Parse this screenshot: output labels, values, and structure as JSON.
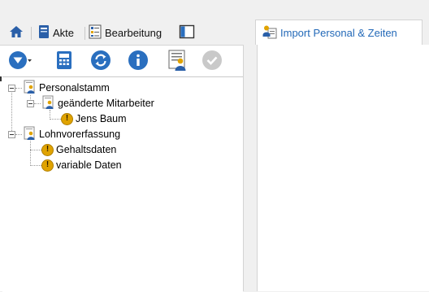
{
  "tabs": {
    "home_icon": "home-icon",
    "akte": "Akte",
    "bearbeitung": "Bearbeitung",
    "layout_icon": "panel-layout-icon"
  },
  "right_tab": {
    "label": "Import Personal & Zeiten",
    "icon": "import-person-icon"
  },
  "toolbar": {
    "icons": [
      "dropdown-filter-icon",
      "calculator-icon",
      "refresh-icon",
      "info-icon",
      "user-report-icon",
      "confirm-icon"
    ]
  },
  "tree": {
    "personalstamm": "Personalstamm",
    "geaenderte_mitarbeiter": "geänderte Mitarbeiter",
    "jens_baum": "Jens Baum",
    "lohnvorerfassung": "Lohnvorerfassung",
    "gehaltsdaten": "Gehaltsdaten",
    "variable_daten": "variable Daten",
    "warn_glyph": "!"
  },
  "colors": {
    "accent_blue": "#2a6fbf",
    "warning": "#e0a300",
    "link_blue": "#2369b8"
  }
}
